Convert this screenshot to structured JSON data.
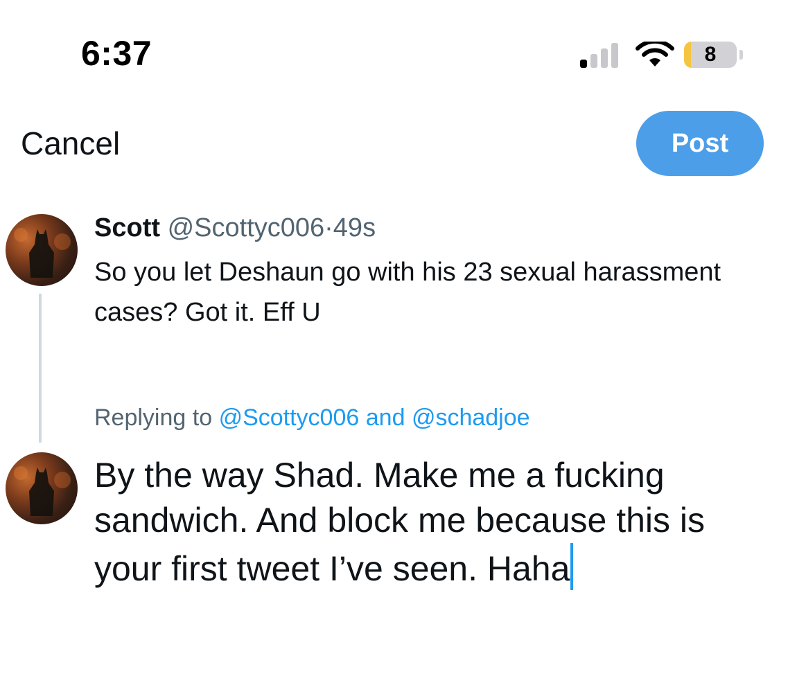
{
  "status_bar": {
    "time": "6:37",
    "battery_level": "8",
    "battery_fraction": 0.08,
    "signal_bars_active": 1,
    "signal_bars_total": 4
  },
  "header": {
    "cancel_label": "Cancel",
    "post_label": "Post"
  },
  "original_tweet": {
    "name": "Scott",
    "handle": "@Scottyc006",
    "separator": "·",
    "time": "49s",
    "text": "So you let Deshaun go with his 23 sexual harassment cases? Got it. Eff U"
  },
  "replying": {
    "prefix": "Replying to",
    "mention_1": "@Scottyc006",
    "conjunction": "and",
    "mention_2": "@schadjoe"
  },
  "composer": {
    "text": "By the way Shad. Make me a fucking sandwich. And block me because this is your first tweet I’ve seen. Haha"
  },
  "colors": {
    "post_button": "#4c9ee8",
    "mention": "#1d9bf0",
    "secondary_text": "#536471",
    "thread_line": "#cfd9de",
    "battery_fill": "#f5c542"
  },
  "icons": {
    "signal": "cellular-signal-icon",
    "wifi": "wifi-icon",
    "battery": "battery-icon"
  }
}
